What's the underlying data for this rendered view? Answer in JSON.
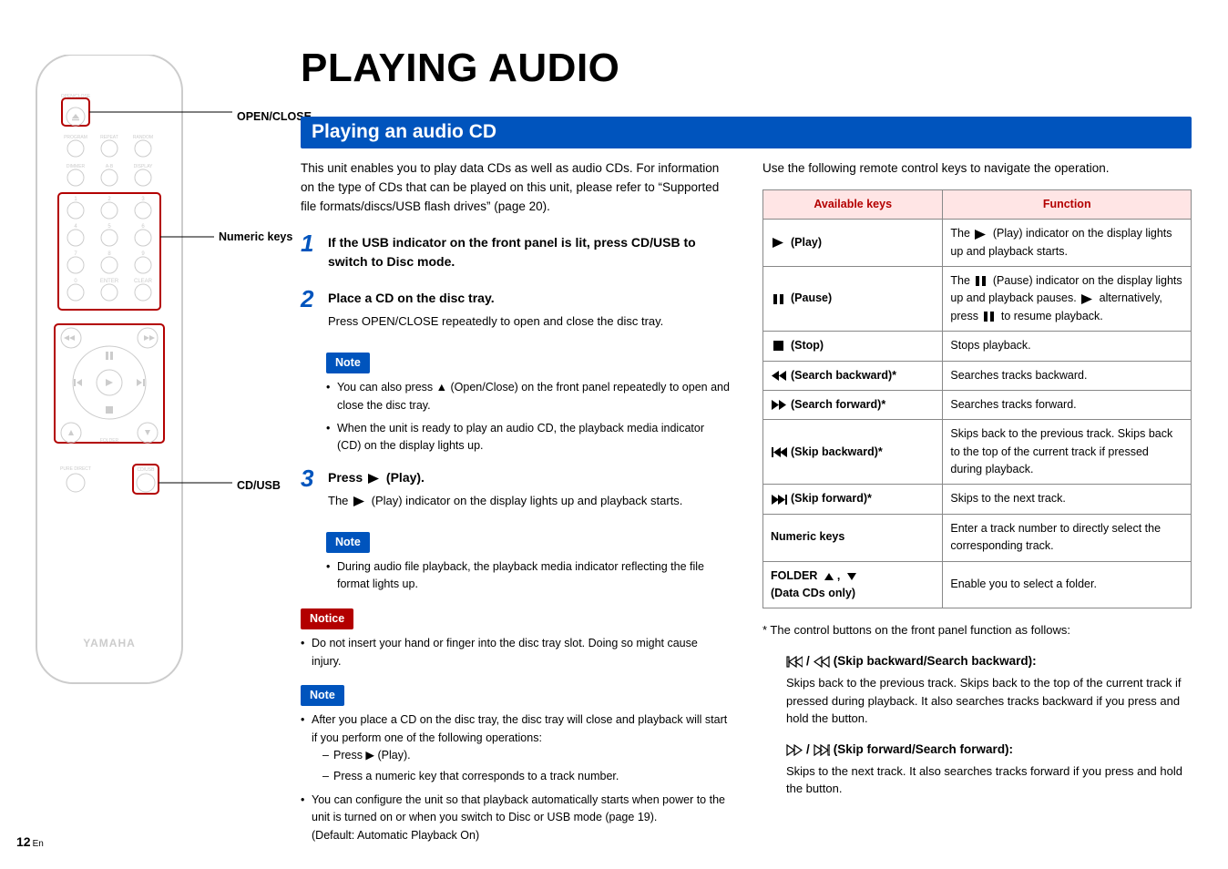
{
  "page_number": "12",
  "page_lang": "En",
  "remote_labels": {
    "open_close": "OPEN/CLOSE",
    "numeric": "Numeric keys",
    "cd_usb": "CD/USB"
  },
  "remote_button_text": {
    "open_close": "OPEN/CLOSE",
    "program": "PROGRAM",
    "repeat": "REPEAT",
    "random": "RANDOM",
    "dimmer": "DIMMER",
    "ab": "A-B",
    "display": "DISPLAY",
    "n1": "1",
    "n2": "2",
    "n3": "3",
    "n4": "4",
    "n5": "5",
    "n6": "6",
    "n7": "7",
    "n8": "8",
    "n9": "9",
    "n0": "0",
    "enter": "ENTER",
    "clear": "CLEAR",
    "folder": "FOLDER",
    "pure": "PURE DIRECT",
    "cdusb": "CD/USB",
    "brand": "YAMAHA"
  },
  "title": "PLAYING AUDIO",
  "section_bar": "Playing an audio CD",
  "intro": "This unit enables you to play data CDs as well as audio CDs. For information on the type of CDs that can be played on this unit, please refer to “Supported file formats/discs/USB flash drives” (page 20).",
  "steps": {
    "s1_title": "If the USB indicator on the front panel is lit, press CD/USB to switch to Disc mode.",
    "s2_title": "Place a CD on the disc tray.",
    "s2_sub": "Press OPEN/CLOSE repeatedly to open and close the disc tray.",
    "s3_title_a": "Press ",
    "s3_title_b": " (Play).",
    "s3_sub_a": "The ",
    "s3_sub_b": " (Play) indicator on the display lights up and playback starts."
  },
  "note_label": "Note",
  "notice_label": "Notice",
  "note1_items": [
    "You can also press ▲ (Open/Close) on the front panel repeatedly to open and close the disc tray.",
    "When the unit is ready to play an audio CD, the playback media indicator (CD) on the display lights up."
  ],
  "note2_items": [
    "During audio file playback, the playback media indicator reflecting the file format lights up."
  ],
  "notice_items": [
    "Do not insert your hand or finger into the disc tray slot. Doing so might cause injury."
  ],
  "note3_intro": "After you place a CD on the disc tray, the disc tray will close and playback will start if you perform one of the following operations:",
  "note3_sub": [
    "Press ▶ (Play).",
    "Press a numeric key that corresponds to a track number."
  ],
  "note3_extra_a": "You can configure the unit so that playback automatically starts when power to the unit is turned on or when you switch to Disc or USB mode (page 19).",
  "note3_extra_b": "(Default: Automatic Playback On)",
  "right_intro": "Use the following remote control keys to navigate the operation.",
  "table": {
    "h1": "Available keys",
    "h2": "Function",
    "rows": [
      {
        "key": "(Play)",
        "icon": "play-f",
        "fn_a": "The ",
        "fn_b": " (Play) indicator on the display lights up and playback starts."
      },
      {
        "key": "(Pause)",
        "icon": "pause-f",
        "fn_a": "The ",
        "fn_mid": " (Pause) indicator on the display lights up and playback pauses. ",
        "fn_b": " alternatively, press ",
        "fn_c": " to resume playback."
      },
      {
        "key": "(Stop)",
        "icon": "stop-f",
        "fn": "Stops playback."
      },
      {
        "key": "(Search backward)*",
        "icon": "rew-f",
        "fn": "Searches tracks backward."
      },
      {
        "key": "(Search forward)*",
        "icon": "ff-f",
        "fn": "Searches tracks forward."
      },
      {
        "key": "(Skip backward)*",
        "icon": "skipb-f",
        "fn": "Skips back to the previous track. Skips back to the top of the current track if pressed during playback."
      },
      {
        "key": "(Skip forward)*",
        "icon": "skipf-f",
        "fn": "Skips to the next track."
      },
      {
        "key": "Numeric keys",
        "icon": "",
        "fn": "Enter a track number to directly select the corresponding track."
      },
      {
        "key_a": "FOLDER ",
        "key_b": " (Data CDs only)",
        "icon": "folder",
        "fn": "Enable you to select a folder."
      }
    ]
  },
  "footnote": "*  The control buttons on the front panel function as follows:",
  "fp": {
    "a_head": " (Skip backward/Search backward):",
    "a_body": "Skips back to the previous track. Skips back to the top of the current track if pressed during playback. It also searches tracks backward if you press and hold the button.",
    "b_head": " (Skip forward/Search forward):",
    "b_body": "Skips to the next track. It also searches tracks forward if you press and hold the button."
  }
}
